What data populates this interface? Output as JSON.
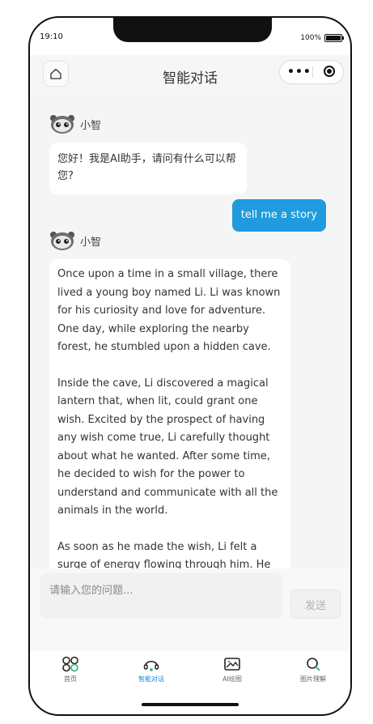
{
  "status_bar": {
    "time": "19:10",
    "battery": "100%"
  },
  "nav": {
    "title": "智能对话",
    "home_icon": "home-icon",
    "more_icon": "more-dots-icon",
    "close_icon": "record-target-icon"
  },
  "messages": {
    "bot_name": "小智",
    "greeting": "您好！我是AI助手，请问有什么可以帮您?",
    "user_message": "tell me a story",
    "story_p1": "Once upon a time in a small village, there lived a young boy named Li. Li was known for his curiosity and love for adventure. One day, while exploring the nearby forest, he stumbled upon a hidden cave.",
    "story_p2": "Inside the cave, Li discovered a magical lantern that, when lit, could grant one wish. Excited by the prospect of having any wish come true, Li carefully thought about what he wanted. After some time, he decided to wish for the power to understand and communicate with all the animals in the world.",
    "story_p3": "As soon as he made the wish, Li felt a surge of energy flowing through him. He could"
  },
  "input": {
    "placeholder": "请输入您的问题...",
    "send_label": "发送"
  },
  "tabs": [
    {
      "label": "首页",
      "icon": "grid-icon"
    },
    {
      "label": "智能对话",
      "icon": "chat-headset-icon"
    },
    {
      "label": "AI绘图",
      "icon": "image-icon"
    },
    {
      "label": "图片理解",
      "icon": "search-icon"
    }
  ],
  "colors": {
    "accent": "#1f9bde",
    "active_tab": "#1a8cd8",
    "icon_green": "#2bb673"
  }
}
